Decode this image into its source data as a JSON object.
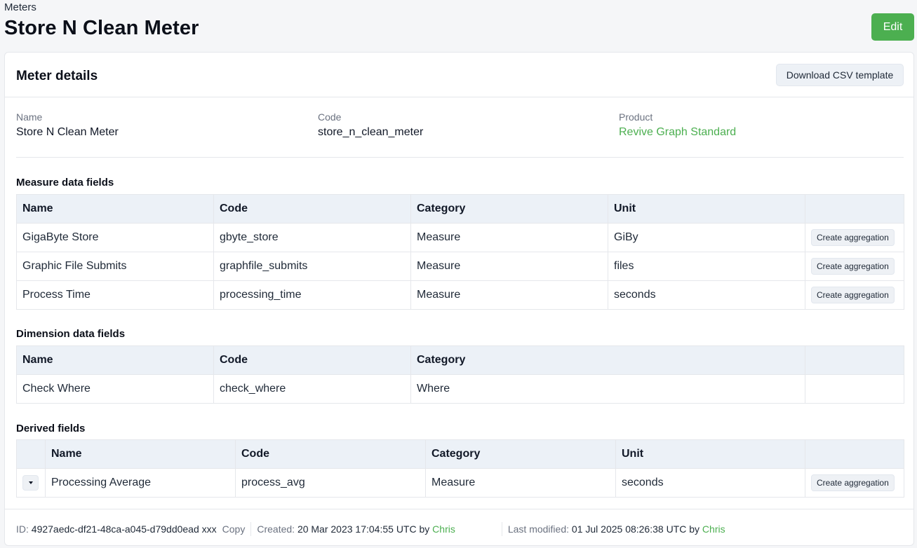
{
  "breadcrumb": "Meters",
  "page_title": "Store N Clean Meter",
  "edit_label": "Edit",
  "card": {
    "title": "Meter details",
    "download_label": "Download CSV template"
  },
  "details": {
    "name_label": "Name",
    "name_value": "Store N Clean Meter",
    "code_label": "Code",
    "code_value": "store_n_clean_meter",
    "product_label": "Product",
    "product_value": "Revive Graph Standard"
  },
  "measure": {
    "title": "Measure data fields",
    "headers": [
      "Name",
      "Code",
      "Category",
      "Unit",
      ""
    ],
    "rows": [
      {
        "name": "GigaByte Store",
        "code": "gbyte_store",
        "category": "Measure",
        "unit": "GiBy",
        "action": "Create aggregation"
      },
      {
        "name": "Graphic File Submits",
        "code": "graphfile_submits",
        "category": "Measure",
        "unit": "files",
        "action": "Create aggregation"
      },
      {
        "name": "Process Time",
        "code": "processing_time",
        "category": "Measure",
        "unit": "seconds",
        "action": "Create aggregation"
      }
    ]
  },
  "dimension": {
    "title": "Dimension data fields",
    "headers": [
      "Name",
      "Code",
      "Category",
      ""
    ],
    "rows": [
      {
        "name": "Check Where",
        "code": "check_where",
        "category": "Where"
      }
    ]
  },
  "derived": {
    "title": "Derived fields",
    "headers": [
      "",
      "Name",
      "Code",
      "Category",
      "Unit",
      ""
    ],
    "rows": [
      {
        "name": "Processing Average",
        "code": "process_avg",
        "category": "Measure",
        "unit": "seconds",
        "action": "Create aggregation"
      }
    ]
  },
  "footer": {
    "id_label": "ID:",
    "id_value": "4927aedc-df21-48ca-a045-d79dd0ead xxx",
    "copy_label": "Copy",
    "created_label": "Created:",
    "created_value": "20 Mar 2023 17:04:55 UTC by",
    "created_by": "Chris",
    "modified_label": "Last modified:",
    "modified_value": "01 Jul 2025 08:26:38 UTC by",
    "modified_by": "Chris"
  },
  "colors": {
    "accent_green": "#4caf50",
    "table_header_bg": "#ecf1f7"
  }
}
